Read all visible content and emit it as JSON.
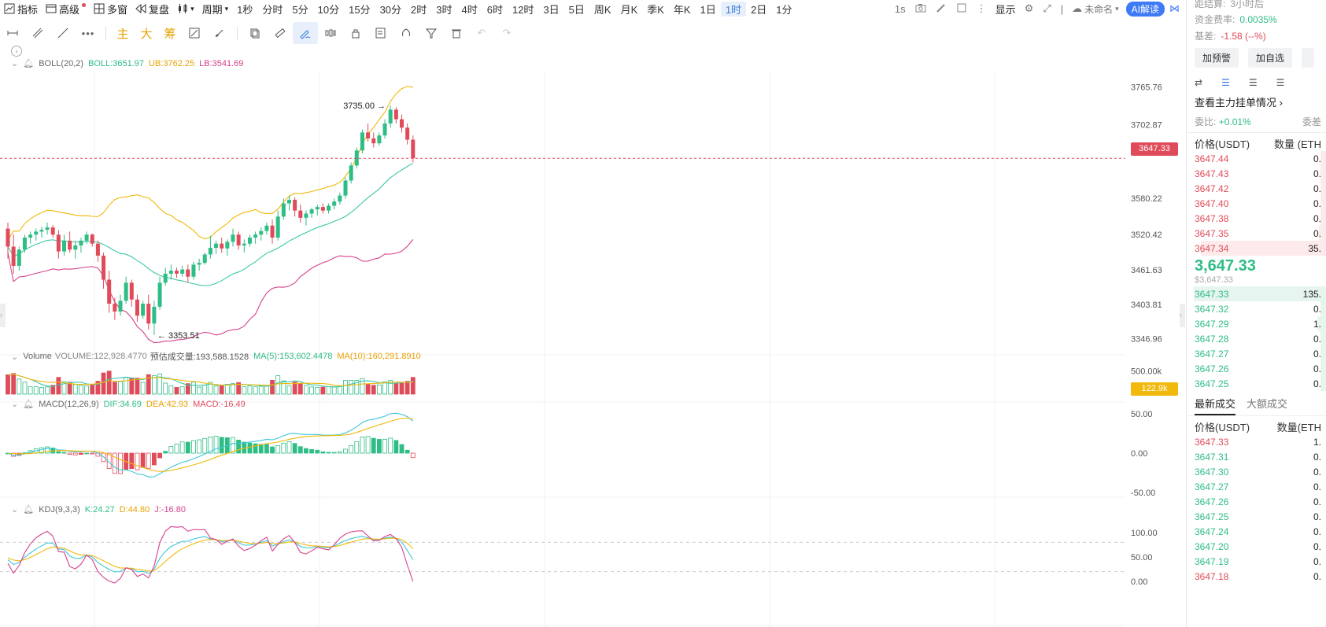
{
  "topbar": {
    "indicators": "指标",
    "advanced": "高级",
    "multi_window": "多窗",
    "replay": "复盘",
    "period": "周期",
    "periods": [
      "1秒",
      "分时",
      "5分",
      "10分",
      "15分",
      "30分",
      "2时",
      "3时",
      "4时",
      "6时",
      "12时",
      "3日",
      "5日",
      "周K",
      "月K",
      "季K",
      "年K",
      "1日",
      "1时",
      "2日",
      "1分"
    ],
    "active_period": "1时",
    "interval": "1s",
    "display": "显示",
    "layout_name": "未命名",
    "ai_button": "AI解读"
  },
  "drawbar": {
    "cn_tools": [
      "主",
      "大",
      "筹"
    ]
  },
  "colors": {
    "up": "#2ebd85",
    "down": "#e04b5a",
    "boll_mid": "#3cc7a8",
    "boll_ub": "#f0b90b",
    "boll_lb": "#d6408c",
    "ma5": "#3cc7a8",
    "ma10": "#f0b90b",
    "k": "#3cc7d8",
    "d": "#f0b90b",
    "j": "#d6408c"
  },
  "boll": {
    "name": "BOLL(20,2)",
    "mid": "BOLL:3651.97",
    "ub": "UB:3762.25",
    "lb": "LB:3541.69"
  },
  "volume_hdr": {
    "name": "Volume",
    "volume": "VOLUME:122,928.4770",
    "est": "预估成交量:193,588.1528",
    "ma5": "MA(5):153,602.4478",
    "ma10": "MA(10):160,291.8910"
  },
  "macd": {
    "name": "MACD(12,26,9)",
    "dif": "DIF:34.69",
    "dea": "DEA:42.93",
    "macd": "MACD:-16.49"
  },
  "kdj": {
    "name": "KDJ(9,3,3)",
    "k": "K:24.27",
    "d": "D:44.80",
    "j": "J:-16.80"
  },
  "axes": {
    "price_ticks": [
      "3765.76",
      "3702.87",
      "3580.22",
      "3520.42",
      "3461.63",
      "3403.81",
      "3346.96"
    ],
    "volume_ticks": [
      "500.00k"
    ],
    "macd_ticks": [
      "50.00",
      "0.00",
      "-50.00"
    ],
    "kdj_ticks": [
      "100.00",
      "50.00",
      "0.00"
    ]
  },
  "markers": {
    "high": "3735.00",
    "low": "3353.51",
    "last_price": "3647.33",
    "last_volume": "122.9k"
  },
  "right": {
    "settle_label": "距结算:",
    "settle_value": "3小时后",
    "funding_label": "资金费率:",
    "funding_value": "0.0035%",
    "basis_label": "基差:",
    "basis_value": "-1.58 (--%)",
    "alert_btn": "加预警",
    "watch_btn": "加自选",
    "depth_link": "查看主力挂单情况",
    "ratio_label": "委比:",
    "ratio_value": "+0.01%",
    "ratio_right": "委差",
    "price_header": "价格(USDT)",
    "qty_header": "数量 (ETH",
    "asks": [
      {
        "price": "3647.44",
        "qty": "0."
      },
      {
        "price": "3647.43",
        "qty": "0."
      },
      {
        "price": "3647.42",
        "qty": "0."
      },
      {
        "price": "3647.40",
        "qty": "0."
      },
      {
        "price": "3647.38",
        "qty": "0."
      },
      {
        "price": "3647.35",
        "qty": "0."
      },
      {
        "price": "3647.34",
        "qty": "35."
      }
    ],
    "last_price": "3,647.33",
    "last_usd": "$3,647.33",
    "bids": [
      {
        "price": "3647.33",
        "qty": "135."
      },
      {
        "price": "3647.32",
        "qty": "0."
      },
      {
        "price": "3647.29",
        "qty": "1."
      },
      {
        "price": "3647.28",
        "qty": "0."
      },
      {
        "price": "3647.27",
        "qty": "0."
      },
      {
        "price": "3647.26",
        "qty": "0."
      },
      {
        "price": "3647.25",
        "qty": "0."
      }
    ],
    "tab_latest": "最新成交",
    "tab_large": "大额成交",
    "trades_price_header": "价格(USDT)",
    "trades_qty_header": "数量(ETH",
    "trades": [
      {
        "price": "3647.33",
        "qty": "1.",
        "side": "down"
      },
      {
        "price": "3647.31",
        "qty": "0.",
        "side": "up"
      },
      {
        "price": "3647.30",
        "qty": "0.",
        "side": "up"
      },
      {
        "price": "3647.27",
        "qty": "0.",
        "side": "up"
      },
      {
        "price": "3647.26",
        "qty": "0.",
        "side": "up"
      },
      {
        "price": "3647.25",
        "qty": "0.",
        "side": "up"
      },
      {
        "price": "3647.24",
        "qty": "0.",
        "side": "up"
      },
      {
        "price": "3647.20",
        "qty": "0.",
        "side": "up"
      },
      {
        "price": "3647.19",
        "qty": "0.",
        "side": "up"
      },
      {
        "price": "3647.18",
        "qty": "0.",
        "side": "down"
      }
    ]
  },
  "chart_data": {
    "type": "candlestick",
    "interval": "1h",
    "ylim": [
      3320,
      3790
    ],
    "candles": [
      [
        3530,
        3540,
        3480,
        3500
      ],
      [
        3500,
        3520,
        3455,
        3468
      ],
      [
        3468,
        3500,
        3460,
        3495
      ],
      [
        3495,
        3520,
        3490,
        3515
      ],
      [
        3515,
        3525,
        3505,
        3520
      ],
      [
        3520,
        3530,
        3510,
        3525
      ],
      [
        3525,
        3533,
        3515,
        3528
      ],
      [
        3528,
        3540,
        3520,
        3532
      ],
      [
        3532,
        3536,
        3515,
        3520
      ],
      [
        3520,
        3528,
        3480,
        3492
      ],
      [
        3492,
        3520,
        3485,
        3510
      ],
      [
        3510,
        3525,
        3490,
        3495
      ],
      [
        3495,
        3510,
        3480,
        3502
      ],
      [
        3502,
        3515,
        3490,
        3510
      ],
      [
        3510,
        3525,
        3505,
        3520
      ],
      [
        3520,
        3522,
        3500,
        3505
      ],
      [
        3505,
        3510,
        3475,
        3485
      ],
      [
        3485,
        3490,
        3430,
        3445
      ],
      [
        3445,
        3460,
        3390,
        3405
      ],
      [
        3405,
        3415,
        3378,
        3392
      ],
      [
        3392,
        3420,
        3385,
        3410
      ],
      [
        3410,
        3450,
        3405,
        3440
      ],
      [
        3440,
        3445,
        3400,
        3412
      ],
      [
        3412,
        3420,
        3375,
        3385
      ],
      [
        3385,
        3410,
        3380,
        3405
      ],
      [
        3405,
        3420,
        3362,
        3372
      ],
      [
        3372,
        3410,
        3353,
        3400
      ],
      [
        3400,
        3450,
        3395,
        3440
      ],
      [
        3440,
        3465,
        3435,
        3455
      ],
      [
        3455,
        3470,
        3445,
        3460
      ],
      [
        3460,
        3465,
        3448,
        3455
      ],
      [
        3455,
        3468,
        3450,
        3462
      ],
      [
        3462,
        3470,
        3440,
        3450
      ],
      [
        3450,
        3475,
        3445,
        3470
      ],
      [
        3470,
        3480,
        3460,
        3473
      ],
      [
        3473,
        3490,
        3470,
        3487
      ],
      [
        3487,
        3518,
        3480,
        3498
      ],
      [
        3498,
        3510,
        3488,
        3505
      ],
      [
        3505,
        3515,
        3490,
        3497
      ],
      [
        3497,
        3512,
        3485,
        3508
      ],
      [
        3508,
        3530,
        3500,
        3520
      ],
      [
        3520,
        3525,
        3495,
        3502
      ],
      [
        3502,
        3512,
        3490,
        3505
      ],
      [
        3505,
        3520,
        3500,
        3515
      ],
      [
        3515,
        3525,
        3505,
        3520
      ],
      [
        3520,
        3532,
        3510,
        3526
      ],
      [
        3526,
        3540,
        3520,
        3535
      ],
      [
        3535,
        3545,
        3505,
        3515
      ],
      [
        3515,
        3560,
        3510,
        3550
      ],
      [
        3550,
        3580,
        3545,
        3572
      ],
      [
        3572,
        3585,
        3560,
        3578
      ],
      [
        3578,
        3582,
        3550,
        3560
      ],
      [
        3560,
        3570,
        3540,
        3548
      ],
      [
        3548,
        3560,
        3535,
        3555
      ],
      [
        3555,
        3565,
        3548,
        3562
      ],
      [
        3562,
        3570,
        3552,
        3566
      ],
      [
        3566,
        3572,
        3555,
        3560
      ],
      [
        3560,
        3572,
        3555,
        3568
      ],
      [
        3568,
        3580,
        3562,
        3575
      ],
      [
        3575,
        3590,
        3570,
        3585
      ],
      [
        3585,
        3615,
        3580,
        3610
      ],
      [
        3610,
        3640,
        3605,
        3635
      ],
      [
        3635,
        3665,
        3630,
        3660
      ],
      [
        3660,
        3695,
        3655,
        3690
      ],
      [
        3690,
        3705,
        3675,
        3680
      ],
      [
        3680,
        3690,
        3665,
        3672
      ],
      [
        3672,
        3690,
        3668,
        3685
      ],
      [
        3685,
        3712,
        3680,
        3705
      ],
      [
        3705,
        3735,
        3698,
        3728
      ],
      [
        3728,
        3732,
        3705,
        3712
      ],
      [
        3712,
        3720,
        3690,
        3698
      ],
      [
        3698,
        3705,
        3670,
        3678
      ],
      [
        3678,
        3685,
        3640,
        3647
      ]
    ],
    "price_ticks": [
      3765.76,
      3702.87,
      3580.22,
      3520.42,
      3461.63,
      3403.81,
      3346.96
    ],
    "volume_max": 700000
  }
}
